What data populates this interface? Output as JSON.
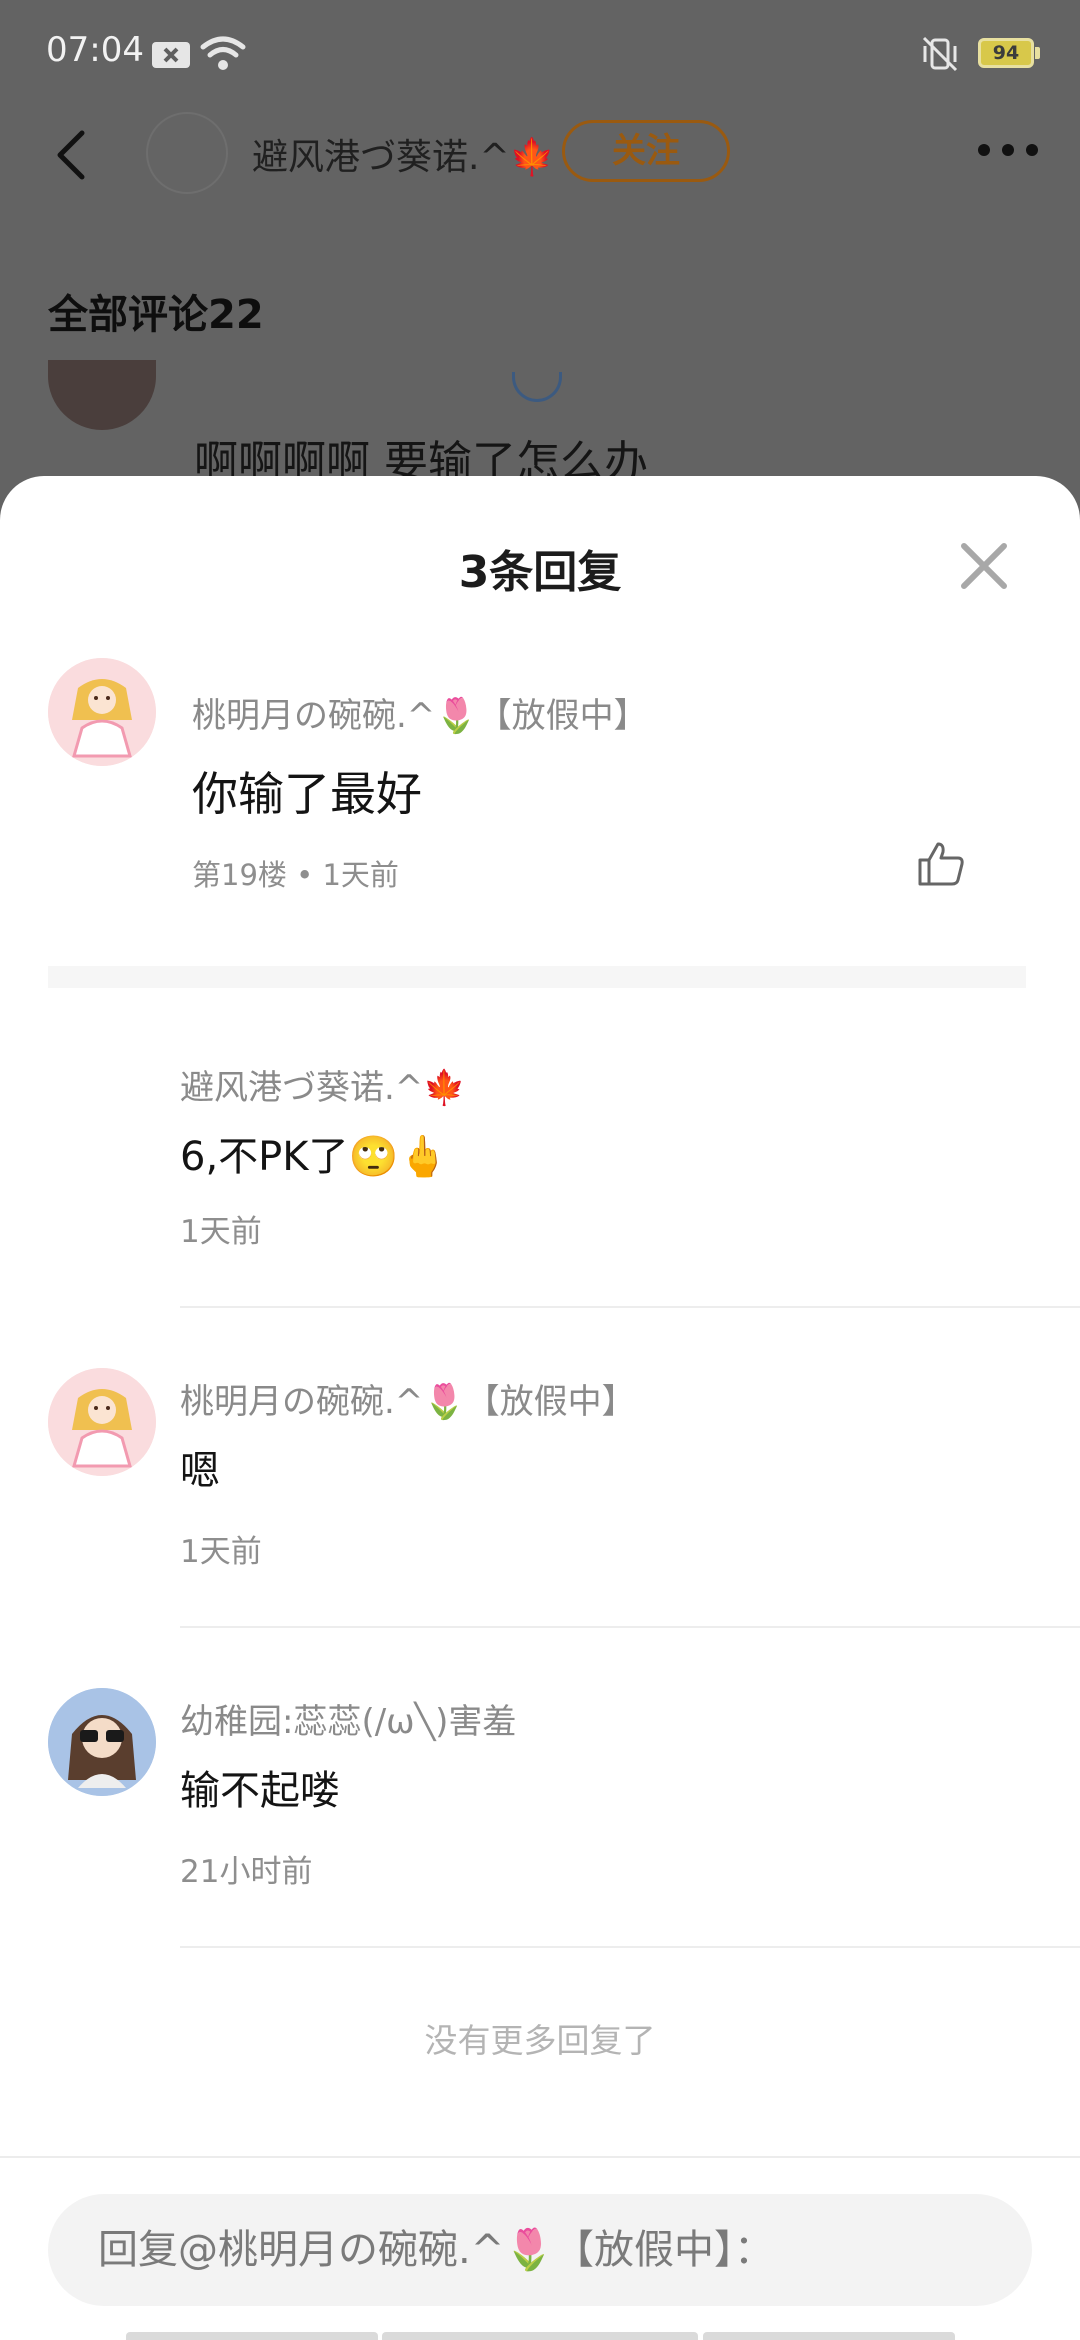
{
  "status_bar": {
    "time": "07:04",
    "battery": "94",
    "icons": [
      "notification-close-icon",
      "wifi-icon",
      "vibrate-mute-icon",
      "battery-icon"
    ]
  },
  "header": {
    "title": "避风港づ葵诺.^🍁",
    "follow_label": "关注",
    "accent_color": "#9a5a10"
  },
  "comments_section": {
    "title": "全部评论22",
    "preview_comment": "啊啊啊啊 要输了怎么办"
  },
  "sheet": {
    "title": "3条回复",
    "main_comment": {
      "user": "桃明月の碗碗.^🌷【放假中】",
      "text": "你输了最好",
      "meta": "第19楼 • 1天前"
    },
    "replies": [
      {
        "user": "避风港づ葵诺.^🍁",
        "text": "6,不PK了🙄🖕",
        "time": "1天前"
      },
      {
        "user": "桃明月の碗碗.^🌷【放假中】",
        "text": "嗯",
        "time": "1天前"
      },
      {
        "user": "幼稚园:蕊蕊(/ω╲)害羞",
        "text": "输不起喽",
        "time": "21小时前"
      }
    ],
    "no_more": "没有更多回复了"
  },
  "reply_box": {
    "placeholder": "回复@桃明月の碗碗.^🌷【放假中】："
  }
}
